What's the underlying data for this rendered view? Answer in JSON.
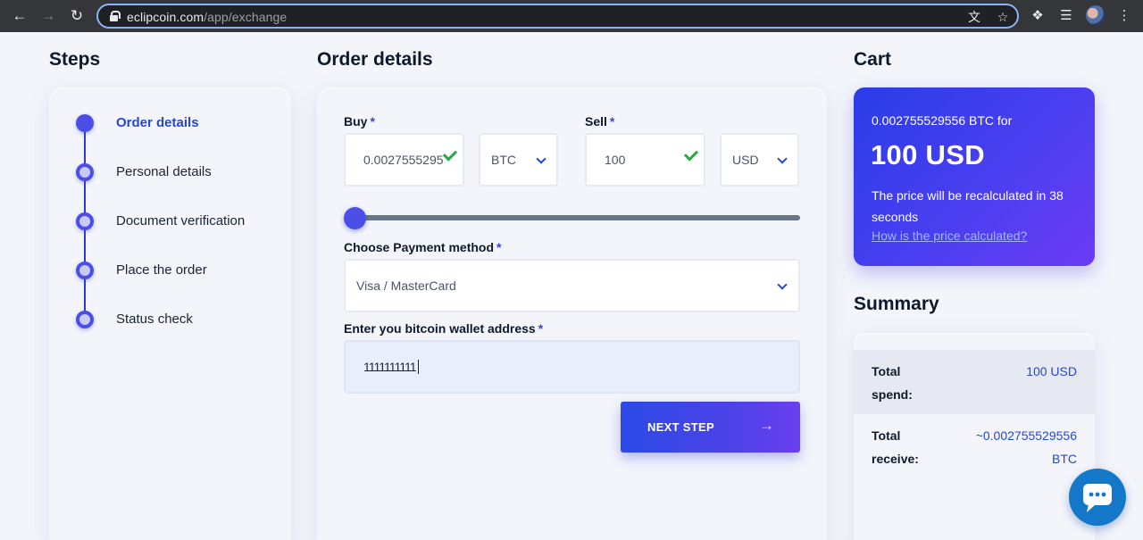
{
  "browser": {
    "url_host": "eclipcoin.com",
    "url_path": "/app/exchange"
  },
  "steps": {
    "title": "Steps",
    "items": [
      {
        "label": "Order details",
        "active": true
      },
      {
        "label": "Personal details",
        "active": false
      },
      {
        "label": "Document verification",
        "active": false
      },
      {
        "label": "Place the order",
        "active": false
      },
      {
        "label": "Status check",
        "active": false
      }
    ]
  },
  "order": {
    "title": "Order details",
    "buy_label": "Buy",
    "buy_value": "0.0027555295",
    "buy_currency": "BTC",
    "sell_label": "Sell",
    "sell_value": "100",
    "sell_currency": "USD",
    "required_mark": "*",
    "slider_value": 0,
    "payment_label": "Choose Payment method",
    "payment_value": "Visa / MasterCard",
    "wallet_label": "Enter you bitcoin wallet address",
    "wallet_value": "1111111111",
    "next_label": "NEXT STEP"
  },
  "cart": {
    "title": "Cart",
    "line1": "0.002755529556 BTC for",
    "amount": "100 USD",
    "recalc": "The price will be recalculated in 38 seconds",
    "link": "How is the price calculated?"
  },
  "summary": {
    "title": "Summary",
    "rows": [
      {
        "key": "Total spend:",
        "value": "100 USD"
      },
      {
        "key": "Total receive:",
        "value": "~0.002755529556 BTC"
      }
    ]
  },
  "colors": {
    "accent": "#2447d6",
    "gradient_start": "#2a3de8",
    "gradient_end": "#6c3bf4",
    "check": "#27a745",
    "chat": "#1478c8"
  }
}
